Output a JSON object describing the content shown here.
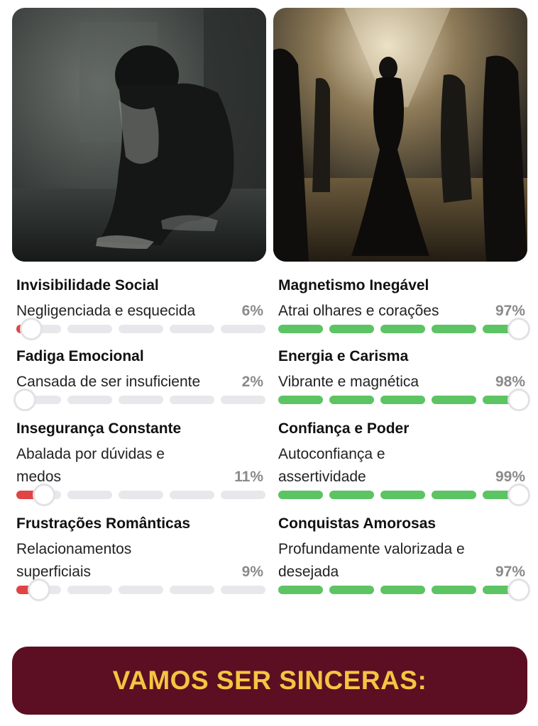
{
  "images": {
    "left_alt": "woman-sitting-alone-dark-room",
    "right_alt": "woman-in-gown-entering-ballroom"
  },
  "colors": {
    "negative_bar": "#e04444",
    "positive_bar": "#5cc463",
    "track": "#e8e8ec",
    "cta_background": "#5c0f22",
    "cta_text": "#f4c542"
  },
  "left_stats": [
    {
      "title": "Invisibilidade Social",
      "subtitle": "Negligenciada e esquecida",
      "percent": "6%",
      "value": 6
    },
    {
      "title": "Fadiga Emocional",
      "subtitle": "Cansada de ser insuficiente",
      "percent": "2%",
      "value": 2
    },
    {
      "title": "Insegurança Constante",
      "subtitle": "Abalada por dúvidas e medos",
      "percent": "11%",
      "value": 11
    },
    {
      "title": "Frustrações Românticas",
      "subtitle": "Relacionamentos superficiais",
      "percent": "9%",
      "value": 9
    }
  ],
  "right_stats": [
    {
      "title": "Magnetismo Inegável",
      "subtitle": "Atrai olhares e corações",
      "percent": "97%",
      "value": 97
    },
    {
      "title": "Energia e Carisma",
      "subtitle": "Vibrante e magnética",
      "percent": "98%",
      "value": 98
    },
    {
      "title": "Confiança e Poder",
      "subtitle": "Autoconfiança e assertividade",
      "percent": "99%",
      "value": 99
    },
    {
      "title": "Conquistas Amorosas",
      "subtitle": "Profundamente valorizada e desejada",
      "percent": "97%",
      "value": 97
    }
  ],
  "cta": {
    "label": "VAMOS SER SINCERAS:"
  }
}
